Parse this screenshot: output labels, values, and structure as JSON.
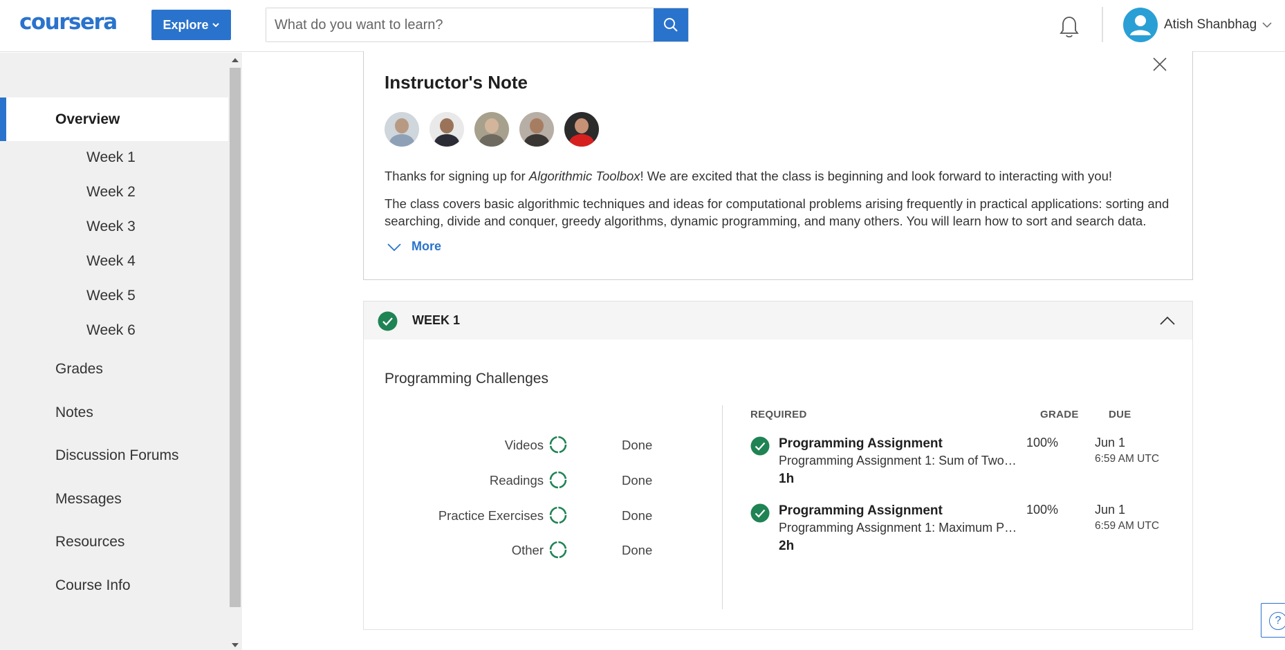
{
  "header": {
    "logo": "coursera",
    "explore_label": "Explore",
    "search_placeholder": "What do you want to learn?",
    "user_name": "Atish Shanbhag",
    "icons": [
      "chevron-down-icon",
      "search-icon",
      "bell-icon",
      "user-avatar-icon"
    ],
    "brand_color": "#2a73cc"
  },
  "sidebar": {
    "active": "Overview",
    "items": [
      {
        "label": "Overview",
        "level": "main"
      },
      {
        "label": "Week 1",
        "level": "week"
      },
      {
        "label": "Week 2",
        "level": "week"
      },
      {
        "label": "Week 3",
        "level": "week"
      },
      {
        "label": "Week 4",
        "level": "week"
      },
      {
        "label": "Week 5",
        "level": "week"
      },
      {
        "label": "Week 6",
        "level": "week"
      },
      {
        "label": "Grades",
        "level": "main"
      },
      {
        "label": "Notes",
        "level": "main"
      },
      {
        "label": "Discussion Forums",
        "level": "main"
      },
      {
        "label": "Messages",
        "level": "main"
      },
      {
        "label": "Resources",
        "level": "main"
      },
      {
        "label": "Course Info",
        "level": "main"
      }
    ]
  },
  "note": {
    "title": "Instructor's Note",
    "p1_before": "Thanks for signing up for ",
    "p1_course": "Algorithmic Toolbox",
    "p1_after": "! We are excited that the class is beginning and look forward to interacting with you!",
    "p2": "The class covers basic algorithmic techniques and ideas for computational problems arising frequently in practical applications: sorting and searching, divide and conquer, greedy algorithms, dynamic programming, and many others. You will learn how to sort and search data.",
    "more_label": "More"
  },
  "week": {
    "title": "WEEK 1",
    "status_color": "#1f8354",
    "section_title": "Programming Challenges",
    "stats": [
      {
        "label": "Videos",
        "value": "Done"
      },
      {
        "label": "Readings",
        "value": "Done"
      },
      {
        "label": "Practice Exercises",
        "value": "Done"
      },
      {
        "label": "Other",
        "value": "Done"
      }
    ],
    "headers": {
      "required": "REQUIRED",
      "grade": "GRADE",
      "due": "DUE"
    },
    "assignments": [
      {
        "type": "Programming Assignment",
        "name": "Programming Assignment 1: Sum of Two…",
        "duration": "1h",
        "grade": "100%",
        "due_date": "Jun 1",
        "due_time": "6:59 AM UTC"
      },
      {
        "type": "Programming Assignment",
        "name": "Programming Assignment 1: Maximum P…",
        "duration": "2h",
        "grade": "100%",
        "due_date": "Jun 1",
        "due_time": "6:59 AM UTC"
      }
    ]
  },
  "help": {
    "label": "?"
  }
}
